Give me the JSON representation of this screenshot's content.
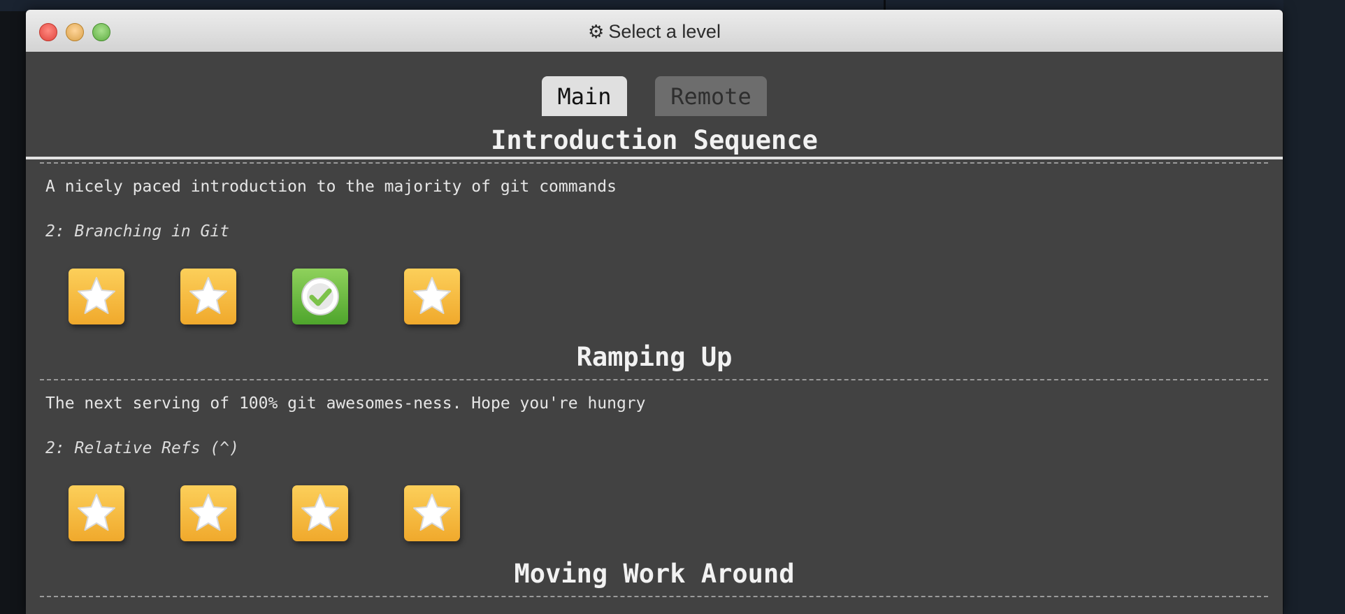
{
  "window": {
    "title": "Select a level",
    "title_icon": "gear-icon"
  },
  "tabs": [
    {
      "label": "Main",
      "selected": true
    },
    {
      "label": "Remote",
      "selected": false
    }
  ],
  "sections": [
    {
      "title": "Introduction Sequence",
      "description": "A nicely paced introduction to the majority of git commands",
      "current_level": "2: Branching in Git",
      "levels": [
        {
          "state": "unsolved",
          "icon": "star-icon"
        },
        {
          "state": "unsolved",
          "icon": "star-icon"
        },
        {
          "state": "solved",
          "icon": "checkmark-icon"
        },
        {
          "state": "unsolved",
          "icon": "star-icon"
        }
      ]
    },
    {
      "title": "Ramping Up",
      "description": "The next serving of 100% git awesomes-ness. Hope you're hungry",
      "current_level": "2: Relative Refs (^)",
      "levels": [
        {
          "state": "unsolved",
          "icon": "star-icon"
        },
        {
          "state": "unsolved",
          "icon": "star-icon"
        },
        {
          "state": "unsolved",
          "icon": "star-icon"
        },
        {
          "state": "unsolved",
          "icon": "star-icon"
        }
      ]
    },
    {
      "title": "Moving Work Around"
    }
  ],
  "colors": {
    "window_bg": "#424242",
    "star_button": "#f5b83a",
    "solved_button": "#6cbb3f"
  }
}
